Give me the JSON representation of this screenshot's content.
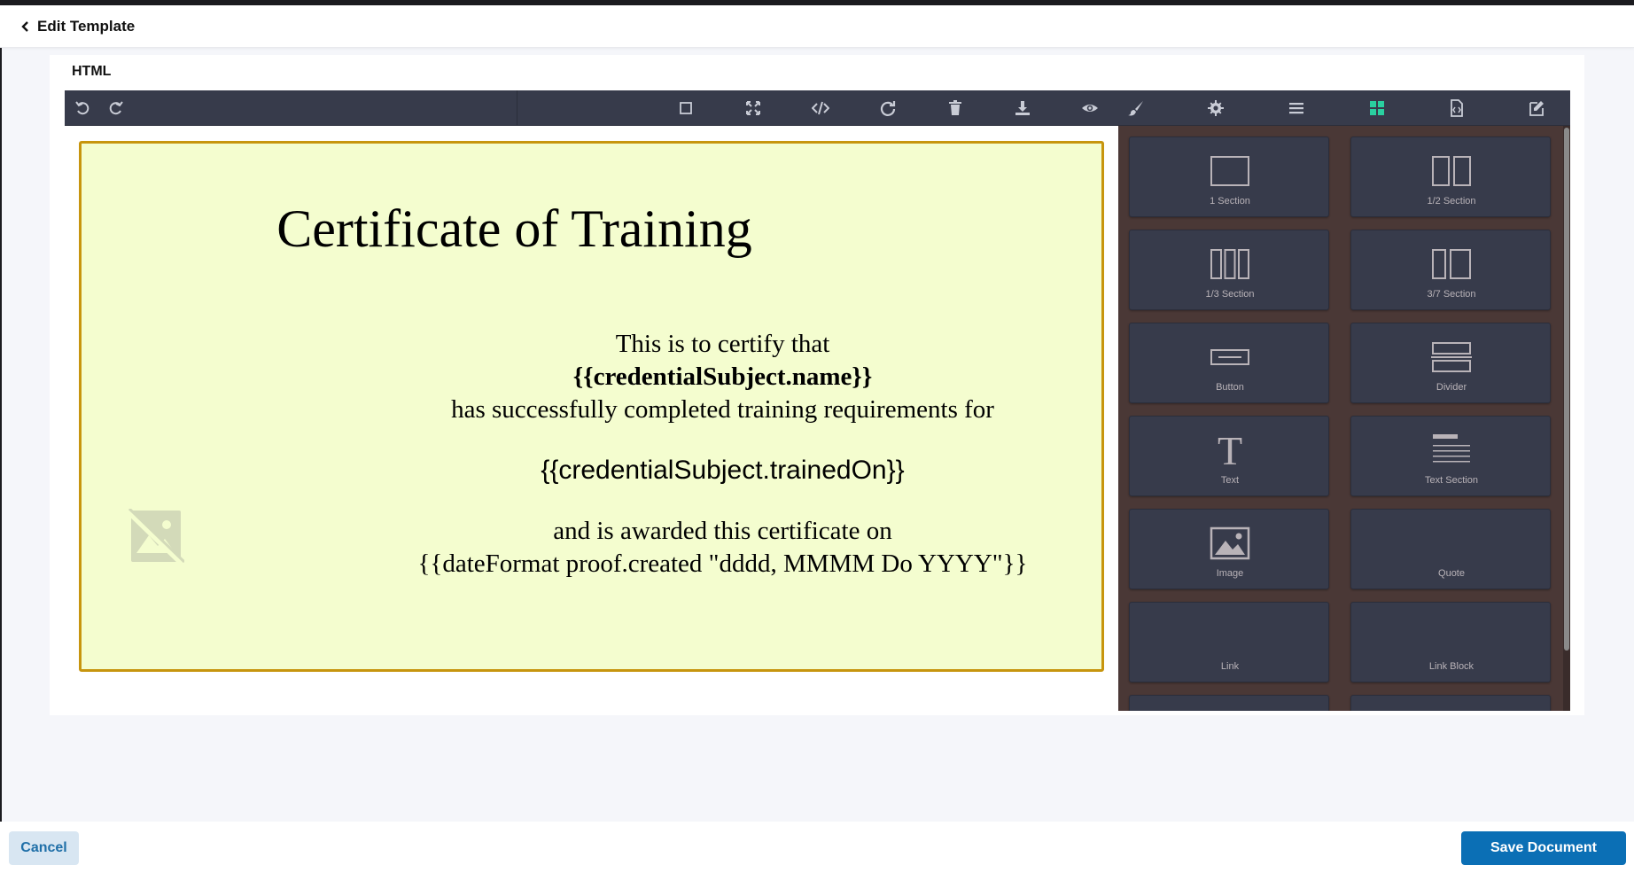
{
  "header": {
    "back_label": "Edit Template"
  },
  "card": {
    "title": "HTML"
  },
  "toolbar": {
    "left_buttons": [
      {
        "name": "undo-icon"
      },
      {
        "name": "redo-icon"
      },
      {
        "name": "sw-visibility-icon"
      },
      {
        "name": "fullscreen-icon"
      },
      {
        "name": "code-icon"
      },
      {
        "name": "refresh-icon"
      },
      {
        "name": "trash-icon"
      },
      {
        "name": "download-icon"
      },
      {
        "name": "preview-icon"
      }
    ],
    "right_buttons": [
      {
        "name": "brush-icon"
      },
      {
        "name": "gear-icon"
      },
      {
        "name": "layers-icon"
      },
      {
        "name": "blocks-icon",
        "active": true
      },
      {
        "name": "html-file-icon"
      },
      {
        "name": "edit-icon"
      }
    ],
    "active_color": "#2ad0a0"
  },
  "certificate": {
    "title": "Certificate of Training",
    "line1": "This is to certify that",
    "name_var": "{{credentialSubject.name}}",
    "line2": "has successfully completed training requirements for",
    "trained_var": "{{credentialSubject.trainedOn}}",
    "line3": "and is awarded this certificate on",
    "date_var": "{{dateFormat proof.created \"dddd, MMMM Do YYYY\"}}",
    "background": "#f4fdcf",
    "border": "#c7950e"
  },
  "blocks": [
    {
      "label": "1 Section",
      "icon": "one-section-icon"
    },
    {
      "label": "1/2 Section",
      "icon": "half-section-icon"
    },
    {
      "label": "1/3 Section",
      "icon": "third-section-icon"
    },
    {
      "label": "3/7 Section",
      "icon": "three-seven-section-icon"
    },
    {
      "label": "Button",
      "icon": "button-block-icon"
    },
    {
      "label": "Divider",
      "icon": "divider-block-icon"
    },
    {
      "label": "Text",
      "icon": "text-block-icon"
    },
    {
      "label": "Text Section",
      "icon": "text-section-icon"
    },
    {
      "label": "Image",
      "icon": "image-block-icon"
    },
    {
      "label": "Quote",
      "icon": ""
    },
    {
      "label": "Link",
      "icon": ""
    },
    {
      "label": "Link Block",
      "icon": ""
    }
  ],
  "footer": {
    "cancel_label": "Cancel",
    "save_label": "Save Document"
  }
}
